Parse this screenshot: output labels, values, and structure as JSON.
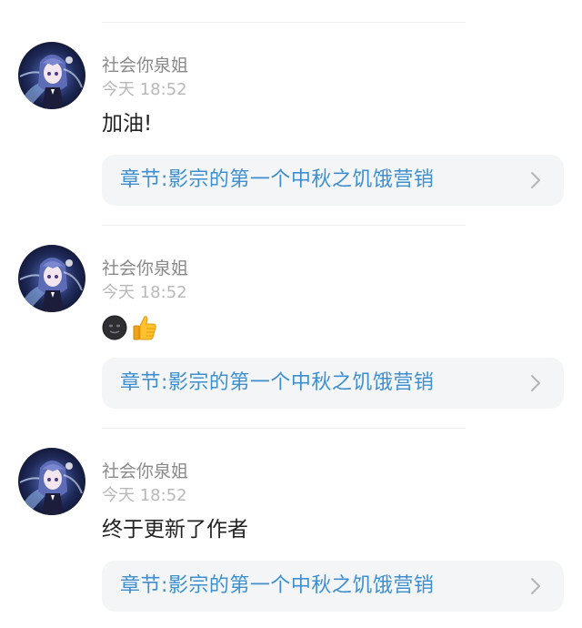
{
  "comments": [
    {
      "username": "社会你泉姐",
      "time": "今天 18:52",
      "text": "加油!",
      "emojis": [],
      "chapter_label": "章节:影宗的第一个中秋之饥饿营销",
      "avatar_icon": "anime-girl-avatar",
      "chevron_icon": "chevron-right-icon"
    },
    {
      "username": "社会你泉姐",
      "time": "今天 18:52",
      "text": "",
      "emojis": [
        "dark-face-emoji",
        "thumbs-up-emoji"
      ],
      "chapter_label": "章节:影宗的第一个中秋之饥饿营销",
      "avatar_icon": "anime-girl-avatar",
      "chevron_icon": "chevron-right-icon"
    },
    {
      "username": "社会你泉姐",
      "time": "今天 18:52",
      "text": "终于更新了作者",
      "emojis": [],
      "chapter_label": "章节:影宗的第一个中秋之饥饿营销",
      "avatar_icon": "anime-girl-avatar",
      "chevron_icon": "chevron-right-icon"
    }
  ],
  "colors": {
    "chapter_text": "#3d8fd0",
    "username": "#8a8a8a",
    "time": "#b8b8b8",
    "card_bg": "#f4f5f7"
  }
}
